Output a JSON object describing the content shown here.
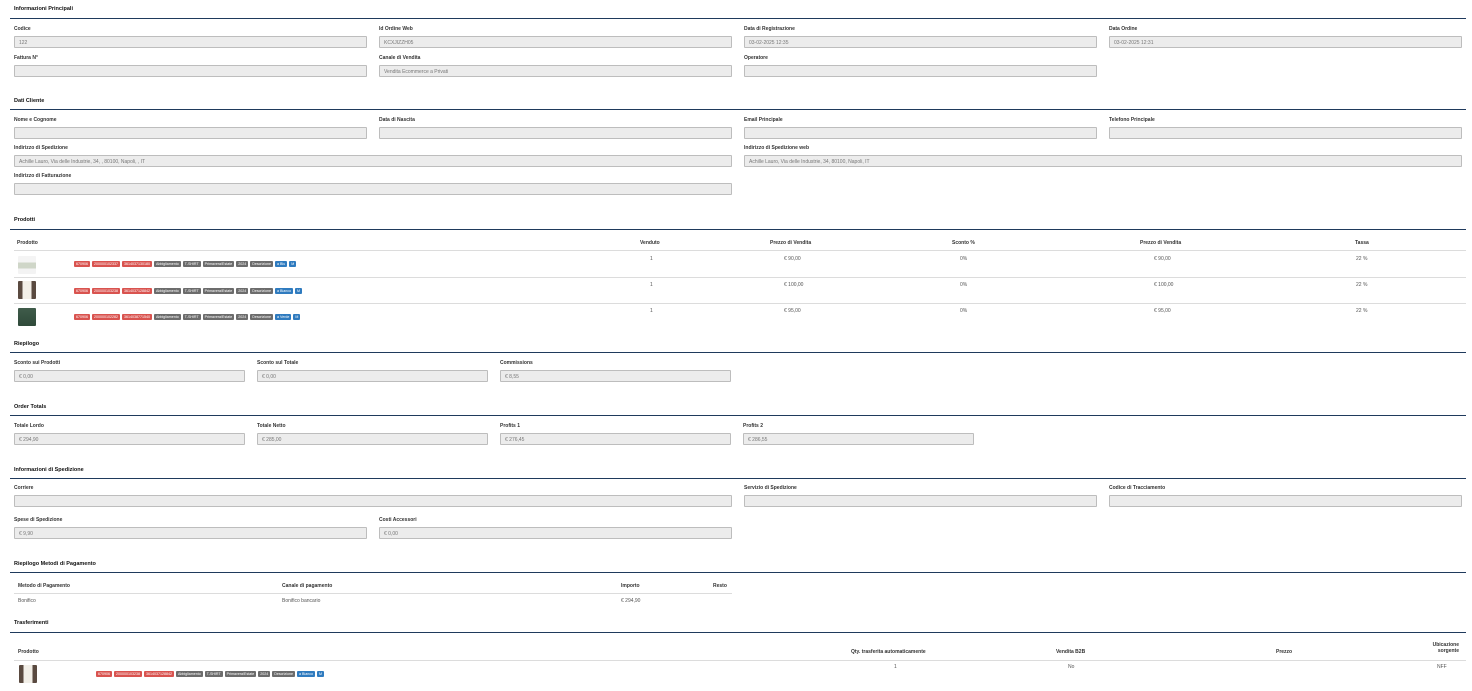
{
  "info": {
    "title": "Informazioni Principali",
    "fields": [
      {
        "label": "Codice",
        "value": "122"
      },
      {
        "label": "Id Ordine Web",
        "value": "KCXJIZZH05"
      },
      {
        "label": "Data di Registrazione",
        "value": "03-02-2025 12:35"
      },
      {
        "label": "Data Ordine",
        "value": "03-02-2025 12:31"
      },
      {
        "label": "Fattura N°",
        "value": ""
      },
      {
        "label": "Canale di Vendita",
        "value": "Vendita Ecommerce a Privati"
      },
      {
        "label": "Operatore",
        "value": ""
      }
    ]
  },
  "cliente": {
    "title": "Dati Cliente",
    "fields": [
      {
        "label": "Nome e Cognome",
        "value": ""
      },
      {
        "label": "Data di Nascita",
        "value": ""
      },
      {
        "label": "Email Principale",
        "value": ""
      },
      {
        "label": "Telefono Principale",
        "value": ""
      },
      {
        "label": "Indirizzo di Spedizione",
        "value": "Achille Lauro, Via delle Industrie, 34, , 80100, Napoli, , IT"
      },
      {
        "label": "Indirizzo di Spedizione web",
        "value": "Achille Lauro, Via delle Industrie, 34, 80100, Napoli, IT"
      },
      {
        "label": "Indirizzo di Fatturazione",
        "value": ""
      }
    ]
  },
  "prodotti": {
    "title": "Prodotti",
    "headers": [
      "Prodotto",
      "Venduto",
      "Prezzo di Vendita",
      "Sconto %",
      "Prezzo di Vendita",
      "Tassa"
    ],
    "rows": [
      {
        "venduto": "1",
        "prezzo": "€ 90,00",
        "sconto": "0%",
        "prezzo2": "€ 90,00",
        "tassa": "22 %",
        "tags": [
          "670906",
          "200000102337",
          "3614037130180",
          "Abbigliamento",
          "T-SHIRT",
          "Primavera/Estate",
          "2024",
          "Descrizione",
          "a Blu",
          "M"
        ]
      },
      {
        "venduto": "1",
        "prezzo": "€ 100,00",
        "sconto": "0%",
        "prezzo2": "€ 100,00",
        "tassa": "22 %",
        "tags": [
          "670906",
          "200000103238",
          "3614037128842",
          "Abbigliamento",
          "T-SHIRT",
          "Primavera/Estate",
          "2024",
          "Descrizione",
          "a Bianco",
          "M"
        ]
      },
      {
        "venduto": "1",
        "prezzo": "€ 95,00",
        "sconto": "0%",
        "prezzo2": "€ 95,00",
        "tassa": "22 %",
        "tags": [
          "670906",
          "200000102282",
          "3614038771540",
          "Abbigliamento",
          "T-SHIRT",
          "Primavera/Estate",
          "2024",
          "Descrizione",
          "a Verde",
          "M"
        ]
      }
    ]
  },
  "riepilogo": {
    "title": "Riepilogo",
    "fields": [
      {
        "label": "Sconto sui Prodotti",
        "value": "€ 0,00"
      },
      {
        "label": "Sconto sul Totale",
        "value": "€ 0,00"
      },
      {
        "label": "Commissions",
        "value": "€ 8,55"
      }
    ]
  },
  "totals": {
    "title": "Order Totals",
    "fields": [
      {
        "label": "Totale Lordo",
        "value": "€ 294,90"
      },
      {
        "label": "Totale Netto",
        "value": "€ 285,00"
      },
      {
        "label": "Profits 1",
        "value": "€ 276,45"
      },
      {
        "label": "Profits 2",
        "value": "€ 286,55"
      }
    ]
  },
  "spedizione": {
    "title": "Informazioni di Spedizione",
    "fields": [
      {
        "label": "Corriere",
        "value": ""
      },
      {
        "label": "Servizio di Spedizione",
        "value": ""
      },
      {
        "label": "Codice di Tracciamento",
        "value": ""
      },
      {
        "label": "Spese di Spedizione",
        "value": "€ 9,90"
      },
      {
        "label": "Costi Accessori",
        "value": "€ 0,00"
      }
    ]
  },
  "pagamenti": {
    "title": "Riepilogo Metodi di Pagamento",
    "headers": [
      "Metodo di Pagamento",
      "Canale di pagamento",
      "Importo",
      "Resto"
    ],
    "row": {
      "metodo": "Bonifico",
      "canale": "Bonifico bancario",
      "importo": "€ 294,90",
      "resto": ""
    }
  },
  "trasferimenti": {
    "title": "Trasferimenti",
    "headers": {
      "prodotto": "Prodotto",
      "qty": "Qty. trasferita automaticamente",
      "b2b": "Vendita B2B",
      "prezzo": "Prezzo",
      "ubic1": "Ubicazione",
      "ubic2": "sorgente"
    },
    "row": {
      "qty": "1",
      "b2b": "No",
      "prezzo": "",
      "ubic": "NFF",
      "tags": [
        "670906",
        "200000103238",
        "3614037128842",
        "Abbigliamento",
        "T-SHIRT",
        "Primavera/Estate",
        "2024",
        "Descrizione",
        "a Bianco",
        "M"
      ]
    }
  },
  "colors": {
    "rule": "#1f3a5c",
    "tag_red": "#d9534f",
    "tag_gray": "#6c6c6c",
    "tag_blue": "#2f7bbf"
  }
}
